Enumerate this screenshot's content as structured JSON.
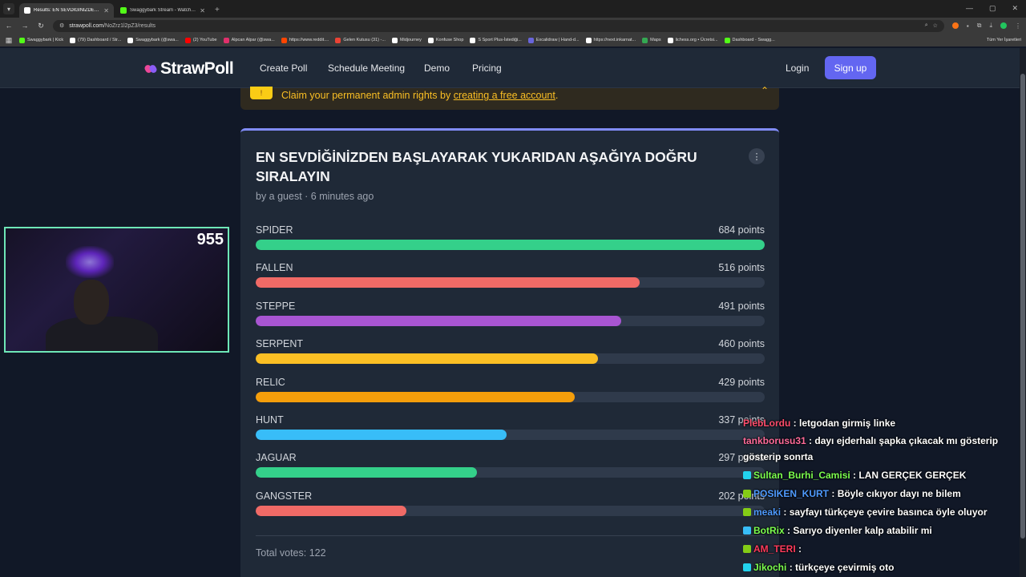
{
  "browser": {
    "tabs": [
      {
        "label": "Results: EN SEVDİĞİNİZDEN BAŞ",
        "active": true,
        "color": "#ffffff"
      },
      {
        "label": "Swaggybark Stream - Watch Liv",
        "active": false,
        "color": "#53fc18"
      }
    ],
    "url": {
      "host": "strawpoll.com",
      "path": "/NoZrz1l2pZ3/results"
    },
    "bookmarks": [
      {
        "label": "Swaggybark | Kick",
        "color": "#53fc18"
      },
      {
        "label": "(79) Dashboard / Str...",
        "color": "#ffffff"
      },
      {
        "label": "Swaggybark (@swa...",
        "color": "#ffffff"
      },
      {
        "label": "(2) YouTube",
        "color": "#ff0000"
      },
      {
        "label": "Alpcan Alpar (@swa...",
        "color": "#e1306c"
      },
      {
        "label": "https://www.reddit....",
        "color": "#ff4500"
      },
      {
        "label": "Gelen Kutusu (31) -...",
        "color": "#ea4335"
      },
      {
        "label": "Midjourney",
        "color": "#ffffff"
      },
      {
        "label": "Konfuse Shop",
        "color": "#ffffff"
      },
      {
        "label": "S Sport Plus-İstediği...",
        "color": "#ffffff"
      },
      {
        "label": "Excalidraw | Hand-d...",
        "color": "#6965db"
      },
      {
        "label": "https://next.inkarnat...",
        "color": "#ffffff"
      },
      {
        "label": "Maps",
        "color": "#34a853"
      },
      {
        "label": "lichess.org • Ücretsi...",
        "color": "#ffffff"
      },
      {
        "label": "Dashboard - Swagg...",
        "color": "#53fc18"
      }
    ],
    "bookmarks_right": "Tüm Yer İşaretleri"
  },
  "site": {
    "logo": "StrawPoll",
    "nav": [
      "Create Poll",
      "Schedule Meeting",
      "Demo",
      "Pricing"
    ],
    "login": "Login",
    "signup": "Sign up"
  },
  "banner": {
    "text_before": "Claim your permanent admin rights by ",
    "link": "creating a free account",
    "text_after": "."
  },
  "poll": {
    "title": "EN SEVDİĞİNİZDEN BAŞLAYARAK YUKARIDAN AŞAĞIYA DOĞRU SIRALAYIN",
    "meta": "by a guest · 6 minutes ago",
    "max_points": 684,
    "options": [
      {
        "name": "SPIDER",
        "points": 684,
        "points_label": "684 points",
        "color": "#34d08a"
      },
      {
        "name": "FALLEN",
        "points": 516,
        "points_label": "516 points",
        "color": "#f06a66"
      },
      {
        "name": "STEPPE",
        "points": 491,
        "points_label": "491 points",
        "color": "#a855d2"
      },
      {
        "name": "SERPENT",
        "points": 460,
        "points_label": "460 points",
        "color": "#fbbf24"
      },
      {
        "name": "RELIC",
        "points": 429,
        "points_label": "429 points",
        "color": "#f59e0b"
      },
      {
        "name": "HUNT",
        "points": 337,
        "points_label": "337 points",
        "color": "#38bdf8"
      },
      {
        "name": "JAGUAR",
        "points": 297,
        "points_label": "297 points",
        "color": "#34d08a"
      },
      {
        "name": "GANGSTER",
        "points": 202,
        "points_label": "202 points",
        "color": "#f06a66"
      }
    ],
    "total": "Total votes: 122"
  },
  "stream": {
    "viewer_count": "955",
    "chat": [
      {
        "user": "PlebLordu",
        "color": "#ff4d6d",
        "text": "letgodan girmiş linke",
        "badge": ""
      },
      {
        "user": "tankborusu31",
        "color": "#ff6b9a",
        "text": "dayı ejderhalı şapka çıkacak mı gösterip gösterip sonrta",
        "badge": ""
      },
      {
        "user": "Sultan_Burhi_Camisi",
        "color": "#7cff4f",
        "text": "LAN GERÇEK GERÇEK",
        "badge": "#22d3ee"
      },
      {
        "user": "POSIKEN_KURT",
        "color": "#4f9bff",
        "text": "Böyle cıkıyor dayı ne bilem",
        "badge": "#84cc16"
      },
      {
        "user": "meaki",
        "color": "#4f9bff",
        "text": "sayfayı türkçeye çevire basınca öyle oluyor",
        "badge": "#84cc16"
      },
      {
        "user": "BotRix",
        "color": "#7cff4f",
        "text": "Sarıyo diyenler kalp atabilir mi",
        "badge": "#38bdf8"
      },
      {
        "user": "AM_TERI",
        "color": "#ff3b5c",
        "text": "",
        "badge": "#84cc16"
      },
      {
        "user": "Jikochi",
        "color": "#7cff4f",
        "text": "türkçeye çevirmiş oto",
        "badge": "#22d3ee"
      }
    ]
  }
}
